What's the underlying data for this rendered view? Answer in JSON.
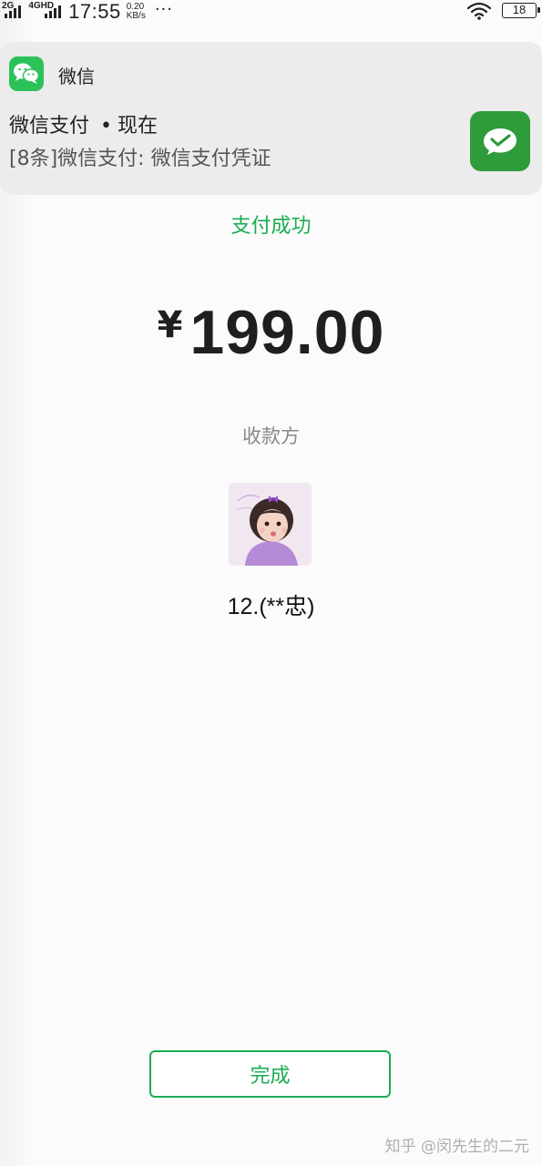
{
  "status_bar": {
    "network_1": "2G",
    "network_2": "4GHD",
    "time": "17:55",
    "speed_value": "0.20",
    "speed_unit": "KB/s",
    "more": "···",
    "battery": "18"
  },
  "notification": {
    "app_name": "微信",
    "title": "微信支付",
    "separator": "•",
    "time": "现在",
    "body": "[8条]微信支付: 微信支付凭证"
  },
  "payment": {
    "status": "支付成功",
    "currency": "¥",
    "amount": "199.00",
    "payee_label": "收款方",
    "payee_name": "12.(**忠)"
  },
  "actions": {
    "done_label": "完成"
  },
  "watermark": "知乎 @闵先生的二元",
  "colors": {
    "accent": "#1aad52",
    "wechat_green": "#2bc25a"
  },
  "icons": {
    "app_icon": "wechat-logo-icon",
    "pay_icon": "wechat-pay-icon"
  }
}
